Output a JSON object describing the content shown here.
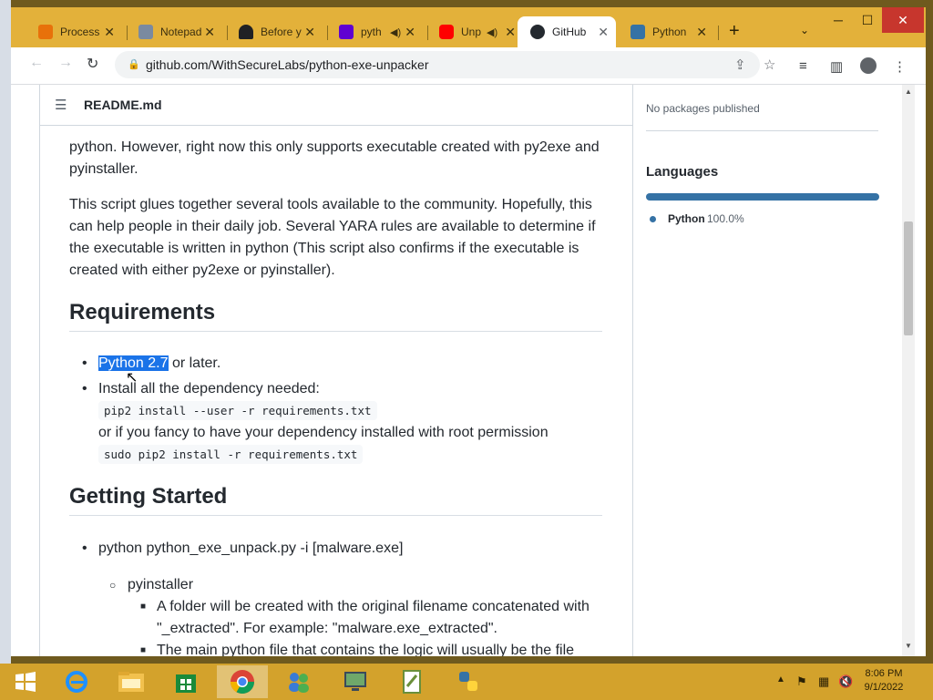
{
  "browser": {
    "tabs": [
      {
        "title": "Process",
        "icon": "process-hacker-icon",
        "color": "#e8710a"
      },
      {
        "title": "Notepad",
        "icon": "notepad-icon",
        "color": "#7a8aa0"
      },
      {
        "title": "Before y",
        "icon": "shield-icon",
        "color": "#202124"
      },
      {
        "title": "pyth",
        "icon": "yahoo-icon",
        "color": "#6001d2"
      },
      {
        "title": "Unp",
        "icon": "youtube-icon",
        "color": "#ff0000"
      },
      {
        "title": "GitHub",
        "icon": "github-icon",
        "color": "#24292f"
      },
      {
        "title": "Python",
        "icon": "python-icon",
        "color": "#3572a5"
      }
    ],
    "active_tab": 5,
    "url": "github.com/WithSecureLabs/python-exe-unpacker"
  },
  "readme": {
    "file": "README.md",
    "para1": "python. However, right now this only supports executable created with py2exe and pyinstaller.",
    "para2": "This script glues together several tools available to the community. Hopefully, this can help people in their daily job. Several YARA rules are available to determine if the executable is written in python (This script also confirms if the executable is created with either py2exe or pyinstaller).",
    "req_heading": "Requirements",
    "req1_link": "Python 2.7",
    "req1_rest": " or later.",
    "req2": "Install all the dependency needed:",
    "code1": "pip2 install --user -r requirements.txt",
    "req2_more": "or if you fancy to have your dependency installed with root permission",
    "code2": "sudo pip2 install -r requirements.txt",
    "gs_heading": "Getting Started",
    "gs1": "python python_exe_unpack.py -i [malware.exe]",
    "gs_sub": "pyinstaller",
    "gs_sub1": "A folder will be created with the original filename concatenated with \"_extracted\". For example: \"malware.exe_extracted\".",
    "gs_sub2": "The main python file that contains the logic will usually be the file"
  },
  "sidebar": {
    "packages": "No packages published",
    "languages_heading": "Languages",
    "languages": [
      {
        "name": "Python",
        "percent": "100.0%",
        "fraction": 1.0,
        "color": "#3572a5"
      }
    ]
  },
  "taskbar": {
    "apps": [
      "start-icon",
      "ie-icon",
      "explorer-icon",
      "store-icon",
      "chrome-icon",
      "people-icon",
      "monitor-icon",
      "notepadpp-icon",
      "python-installer-icon"
    ],
    "time": "8:06 PM",
    "date": "9/1/2022"
  }
}
